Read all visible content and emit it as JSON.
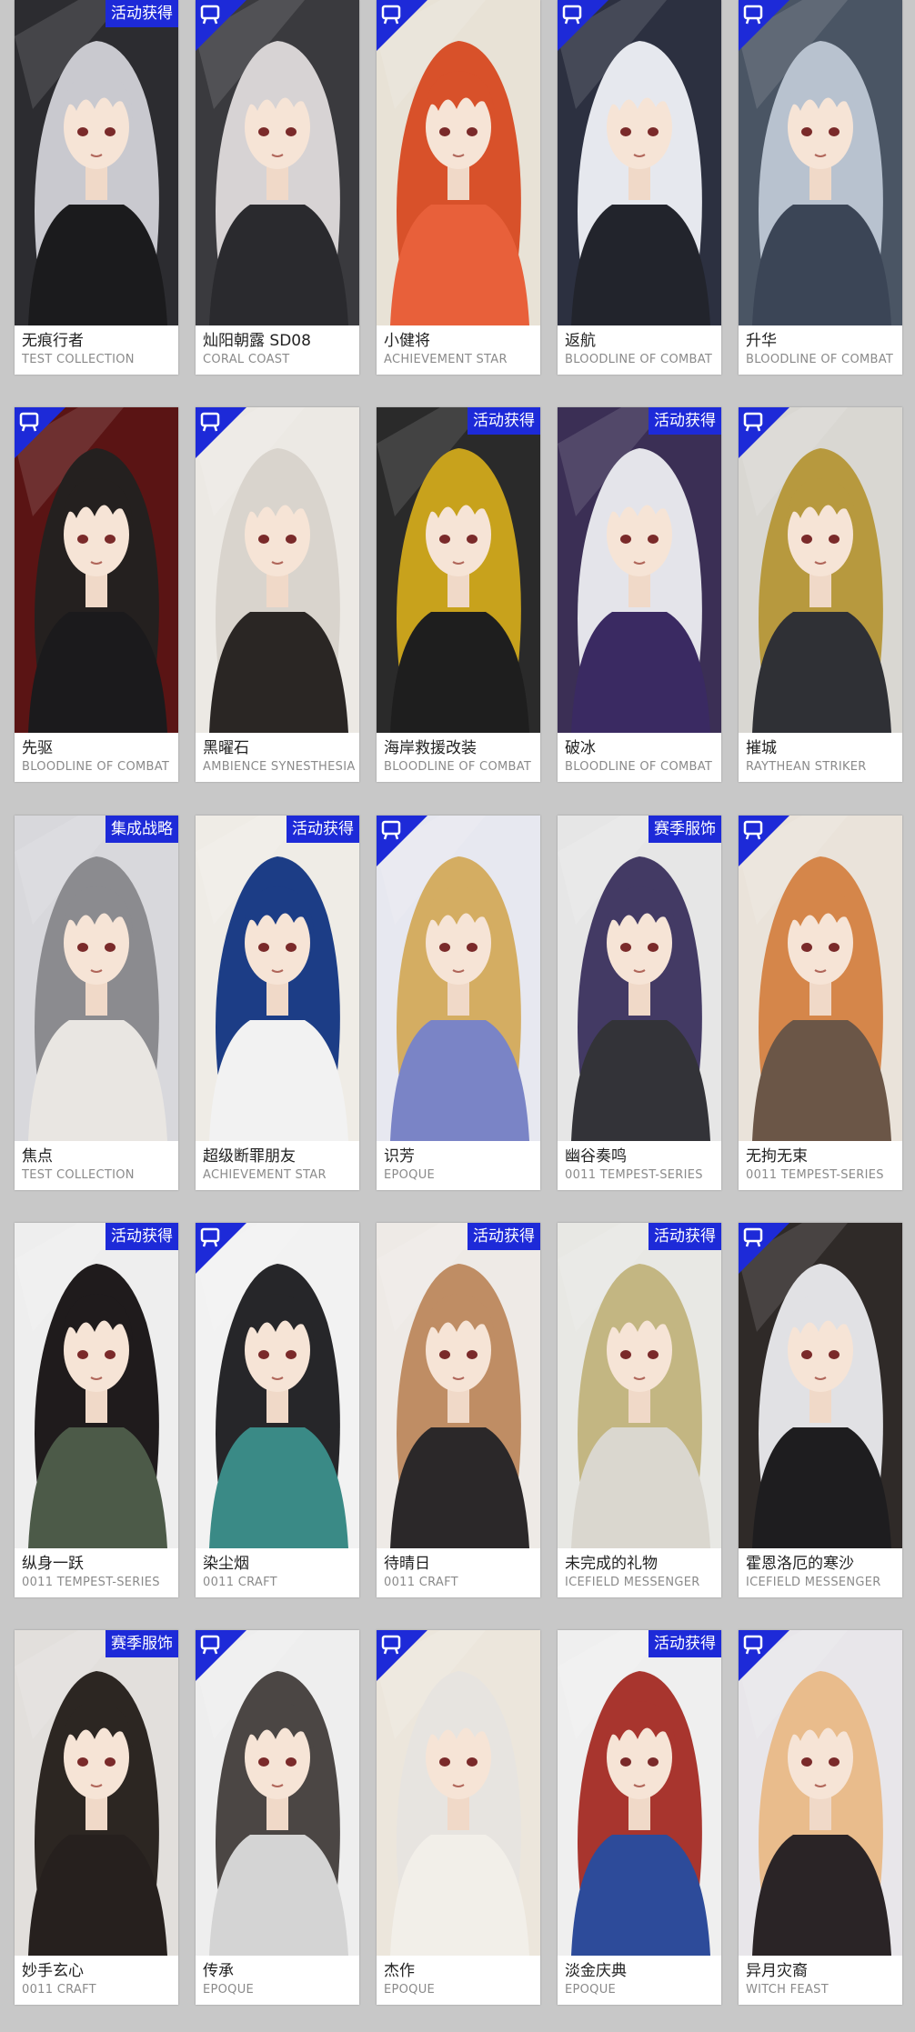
{
  "cards": [
    {
      "name": "无痕行者",
      "series": "TEST COLLECTION",
      "badge": "活动获得",
      "hair": "#c9c9cf",
      "bg": "#2c2c30",
      "outfit": "#1b1b1d"
    },
    {
      "name": "灿阳朝露 SD08",
      "series": "CORAL COAST",
      "badge": "",
      "hair": "#d7d3d4",
      "bg": "#3a3a3e",
      "outfit": "#2a2a2e"
    },
    {
      "name": "小健将",
      "series": "ACHIEVEMENT STAR",
      "badge": "",
      "hair": "#d8512a",
      "bg": "#e8e2d6",
      "outfit": "#e8603a"
    },
    {
      "name": "返航",
      "series": "BLOODLINE OF COMBAT",
      "badge": "",
      "hair": "#e6e8ee",
      "bg": "#2c3040",
      "outfit": "#22242c"
    },
    {
      "name": "升华",
      "series": "BLOODLINE OF COMBAT",
      "badge": "",
      "hair": "#b8c2cf",
      "bg": "#4a5564",
      "outfit": "#3b4556"
    },
    {
      "name": "先驱",
      "series": "BLOODLINE OF COMBAT",
      "badge": "",
      "hair": "#24201f",
      "bg": "#5a1414",
      "outfit": "#1b1a1c"
    },
    {
      "name": "黑曜石",
      "series": "AMBIENCE SYNESTHESIA",
      "badge": "",
      "hair": "#d9d4cd",
      "bg": "#ece9e4",
      "outfit": "#2a2624"
    },
    {
      "name": "海岸救援改装",
      "series": "BLOODLINE OF COMBAT",
      "badge": "活动获得",
      "hair": "#c8a21c",
      "bg": "#2a2a2a",
      "outfit": "#1e1e1e"
    },
    {
      "name": "破冰",
      "series": "BLOODLINE OF COMBAT",
      "badge": "活动获得",
      "hair": "#e4e4ea",
      "bg": "#3b2f55",
      "outfit": "#3a2a62"
    },
    {
      "name": "摧城",
      "series": "RAYTHEAN STRIKER",
      "badge": "",
      "hair": "#b7993e",
      "bg": "#d9d7d2",
      "outfit": "#2f3035"
    },
    {
      "name": "焦点",
      "series": "TEST COLLECTION",
      "badge": "集成战略",
      "hair": "#8b8b8f",
      "bg": "#d8d8dc",
      "outfit": "#e9e6e2"
    },
    {
      "name": "超级断罪朋友",
      "series": "ACHIEVEMENT STAR",
      "badge": "活动获得",
      "hair": "#1c3d86",
      "bg": "#efece6",
      "outfit": "#f2f2f2"
    },
    {
      "name": "识芳",
      "series": "EPOQUE",
      "badge": "",
      "hair": "#d4ad62",
      "bg": "#e7e8f0",
      "outfit": "#7a84c6"
    },
    {
      "name": "幽谷奏鸣",
      "series": "0011 TEMPEST-SERIES",
      "badge": "赛季服饰",
      "hair": "#433a64",
      "bg": "#e6e6e6",
      "outfit": "#333338"
    },
    {
      "name": "无拘无束",
      "series": "0011 TEMPEST-SERIES",
      "badge": "",
      "hair": "#d5864a",
      "bg": "#eae3da",
      "outfit": "#6b5647"
    },
    {
      "name": "纵身一跃",
      "series": "0011 TEMPEST-SERIES",
      "badge": "活动获得",
      "hair": "#1f1b1c",
      "bg": "#eeeeee",
      "outfit": "#4c5a48"
    },
    {
      "name": "染尘烟",
      "series": "0011 CRAFT",
      "badge": "",
      "hair": "#262629",
      "bg": "#f2f2f2",
      "outfit": "#3a8a86"
    },
    {
      "name": "待晴日",
      "series": "0011 CRAFT",
      "badge": "活动获得",
      "hair": "#bf8d64",
      "bg": "#eeeae6",
      "outfit": "#2b2829"
    },
    {
      "name": "未完成的礼物",
      "series": "ICEFIELD MESSENGER",
      "badge": "活动获得",
      "hair": "#c3b682",
      "bg": "#e8e8e4",
      "outfit": "#dad7cf"
    },
    {
      "name": "霍恩洛厄的寒沙",
      "series": "ICEFIELD MESSENGER",
      "badge": "",
      "hair": "#e1e1e4",
      "bg": "#2f2a28",
      "outfit": "#1e1d1f"
    },
    {
      "name": "妙手玄心",
      "series": "0011 CRAFT",
      "badge": "赛季服饰",
      "hair": "#2c2622",
      "bg": "#e2dfdc",
      "outfit": "#26201e"
    },
    {
      "name": "传承",
      "series": "EPOQUE",
      "badge": "",
      "hair": "#4b4644",
      "bg": "#eeeeee",
      "outfit": "#d4d4d4"
    },
    {
      "name": "杰作",
      "series": "EPOQUE",
      "badge": "",
      "hair": "#e7e4e0",
      "bg": "#ece6dc",
      "outfit": "#f2efe9"
    },
    {
      "name": "淡金庆典",
      "series": "EPOQUE",
      "badge": "活动获得",
      "hair": "#a8352e",
      "bg": "#efefef",
      "outfit": "#2d4b9a"
    },
    {
      "name": "异月灾裔",
      "series": "WITCH FEAST",
      "badge": "",
      "hair": "#e9bc8c",
      "bg": "#e8e6ea",
      "outfit": "#2a2426"
    }
  ],
  "colors": {
    "badge": "#1d2ad8",
    "page_bg": "#c8c8c8",
    "card_bg": "#ffffff"
  }
}
